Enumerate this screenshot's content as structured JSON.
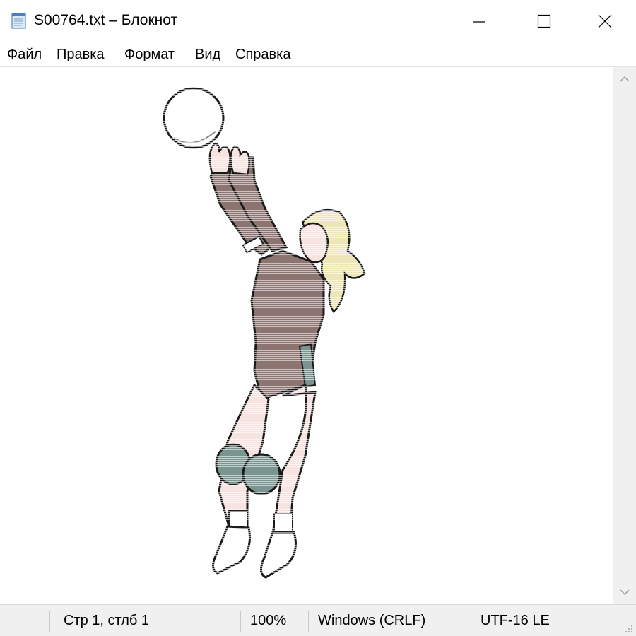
{
  "window": {
    "title": "S00764.txt – Блокнот",
    "icon": "notepad-icon",
    "controls": {
      "minimize": "minimize-icon",
      "maximize": "maximize-icon",
      "close": "close-icon"
    }
  },
  "menu": {
    "items": [
      "Файл",
      "Правка",
      "Формат",
      "Вид",
      "Справка"
    ]
  },
  "editor": {
    "content": "ascii-art-volleyball-player",
    "colors": {
      "outline": "#1a1a1a",
      "suit": "#8c7470",
      "skin": "#f7e3e0",
      "kneepad": "#7a9490",
      "hair": "#efe6b8"
    }
  },
  "status": {
    "position": "Стр 1, стлб 1",
    "zoom": "100%",
    "line_endings": "Windows (CRLF)",
    "encoding": "UTF-16 LE"
  }
}
